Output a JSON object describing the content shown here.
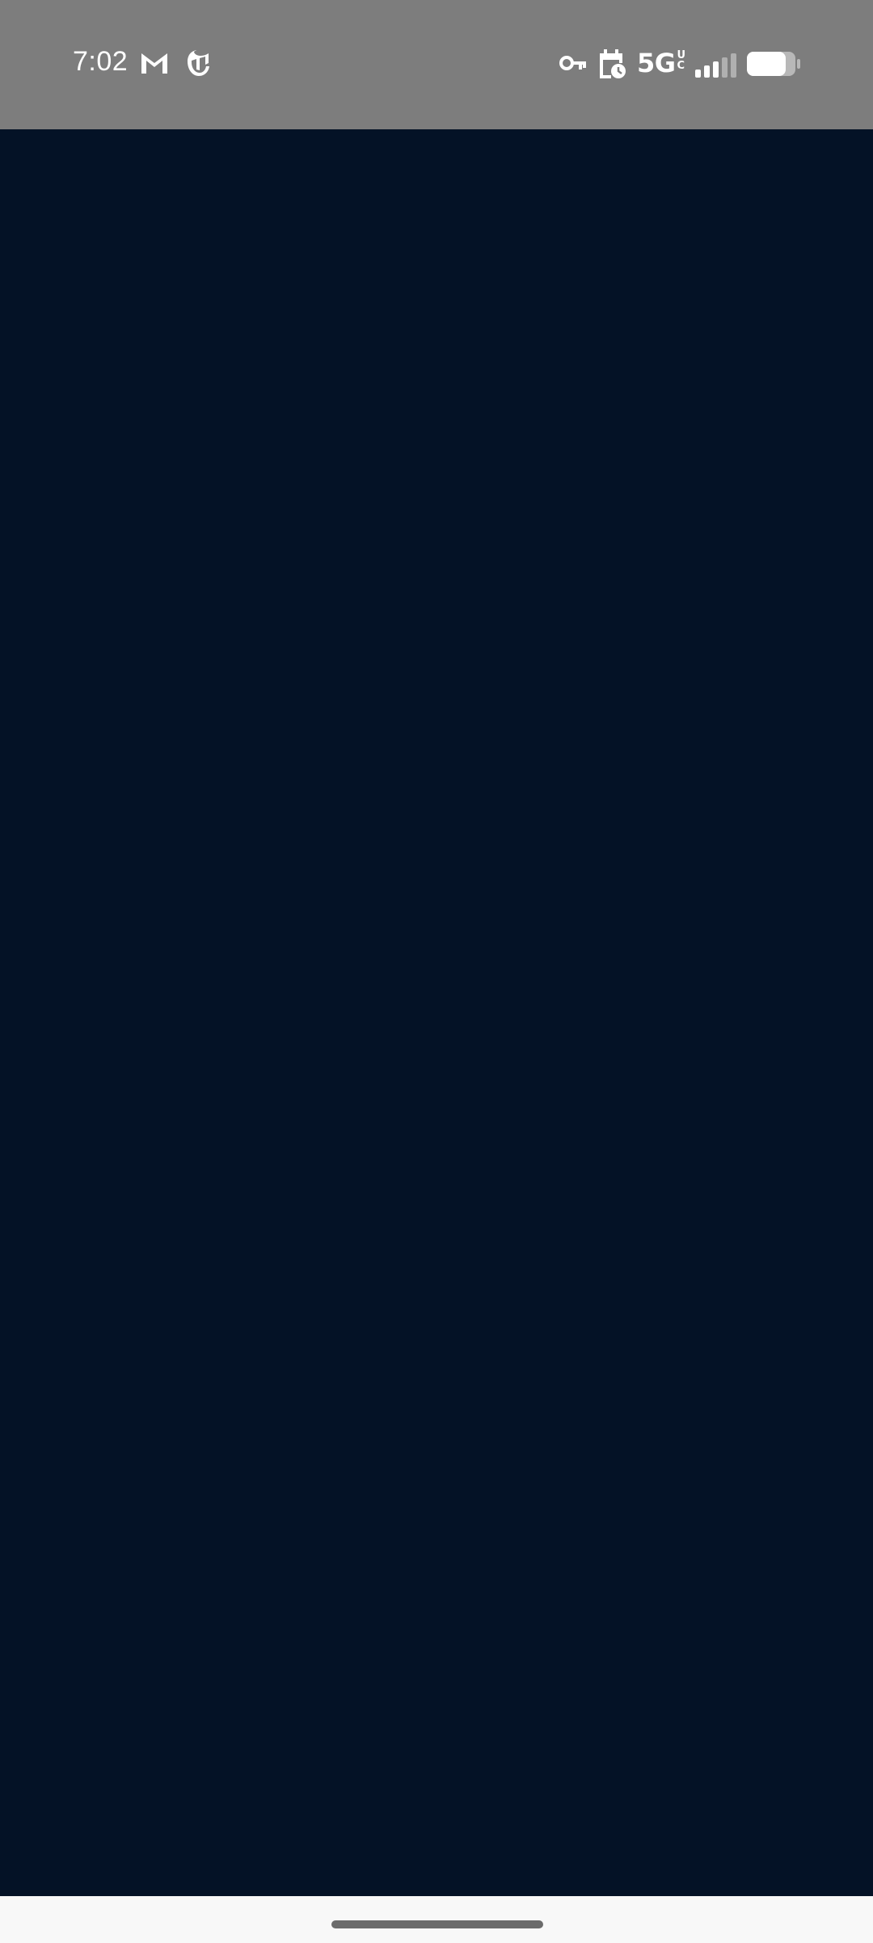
{
  "status_bar": {
    "time": "7:02",
    "network_type": "5G",
    "network_suffix": "UC",
    "signal_bars_filled": 3,
    "signal_bars_total": 5,
    "battery_level": 0.8,
    "notification_icons": [
      "gmail-icon",
      "nyt-icon"
    ],
    "system_icons": [
      "vpn-key-icon",
      "calendar-icon",
      "signal-icon",
      "battery-icon"
    ],
    "background_color": "#7d7d7d"
  },
  "main": {
    "background_color": "#041226"
  },
  "nav_bar": {
    "background_color": "#f8f8f8",
    "handle_color": "#6b6b6b"
  }
}
